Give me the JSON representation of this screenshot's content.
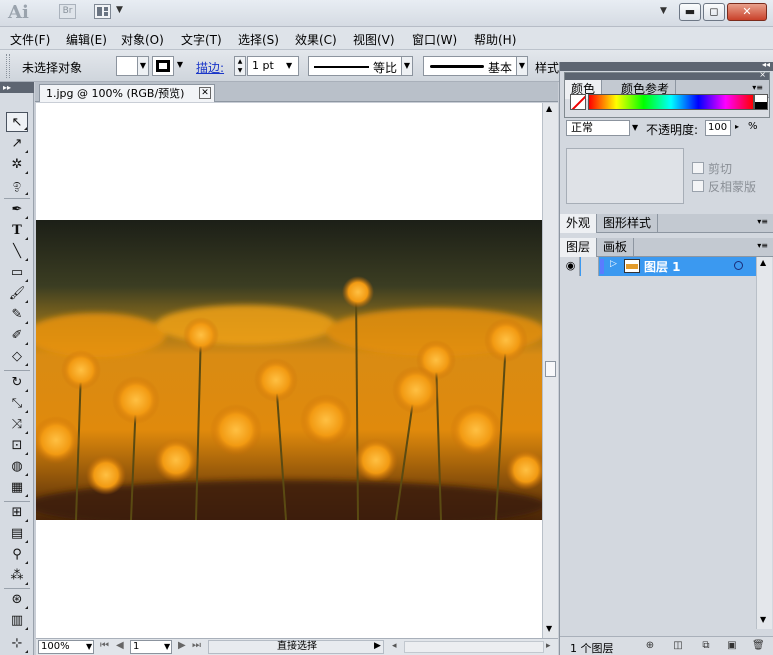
{
  "titlebar": {
    "app_logo": "Ai",
    "bridge_logo": "Br",
    "window_buttons": {
      "minimize": "▬",
      "restore": "◻",
      "close": "✕"
    }
  },
  "menu": [
    "文件(F)",
    "编辑(E)",
    "对象(O)",
    "文字(T)",
    "选择(S)",
    "效果(C)",
    "视图(V)",
    "窗口(W)",
    "帮助(H)"
  ],
  "control": {
    "selection_status": "未选择对象",
    "stroke_label": "描边:",
    "stroke_weight": "1 pt",
    "profile_label": "等比",
    "brush_label": "基本",
    "style_label": "样式:"
  },
  "document": {
    "tab_title": "1.jpg @ 100% (RGB/预览)",
    "close_glyph": "✕"
  },
  "status": {
    "zoom": "100%",
    "artboard": "1",
    "tool_status": "直接选择"
  },
  "panels": {
    "color_tabs": [
      "颜色",
      "颜色参考"
    ],
    "blend_mode": "正常",
    "opacity_label": "不透明度:",
    "opacity_value": "100",
    "opacity_unit": "%",
    "mask_options": [
      "剪切",
      "反相蒙版"
    ],
    "appearance_tabs": [
      "外观",
      "图形样式"
    ],
    "layer_tabs": [
      "图层",
      "画板"
    ],
    "layer_name": "图层 1",
    "layer_count": "1 个图层"
  },
  "tools": [
    "selection-tool",
    "direct-selection-tool",
    "magic-wand-tool",
    "lasso-tool",
    "pen-tool",
    "type-tool",
    "line-segment-tool",
    "rectangle-tool",
    "paintbrush-tool",
    "pencil-tool",
    "blob-brush-tool",
    "eraser-tool",
    "rotate-tool",
    "scale-tool",
    "width-tool",
    "free-transform-tool",
    "shape-builder-tool",
    "perspective-grid-tool",
    "mesh-tool",
    "gradient-tool",
    "eyedropper-tool",
    "blend-tool",
    "symbol-sprayer-tool",
    "column-graph-tool",
    "artboard-tool"
  ],
  "colors": {
    "accent": "#3b99f0",
    "link": "#1a36c8"
  }
}
